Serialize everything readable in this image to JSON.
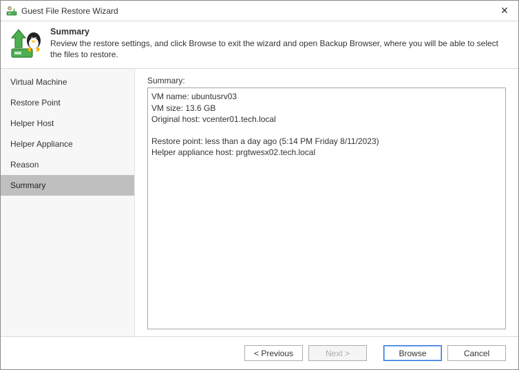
{
  "window": {
    "title": "Guest File Restore Wizard",
    "close_glyph": "✕"
  },
  "header": {
    "title": "Summary",
    "description": "Review the restore settings, and click Browse to exit the wizard and open Backup Browser, where you will be able to select the files to restore."
  },
  "sidebar": {
    "steps": [
      {
        "label": "Virtual Machine",
        "active": false
      },
      {
        "label": "Restore Point",
        "active": false
      },
      {
        "label": "Helper Host",
        "active": false
      },
      {
        "label": "Helper Appliance",
        "active": false
      },
      {
        "label": "Reason",
        "active": false
      },
      {
        "label": "Summary",
        "active": true
      }
    ]
  },
  "main": {
    "field_label": "Summary:",
    "summary_text": "VM name: ubuntusrv03\nVM size: 13.6 GB\nOriginal host: vcenter01.tech.local\n\nRestore point: less than a day ago (5:14 PM Friday 8/11/2023)\nHelper appliance host: prgtwesx02.tech.local"
  },
  "footer": {
    "previous": "< Previous",
    "next": "Next >",
    "browse": "Browse",
    "cancel": "Cancel"
  },
  "colors": {
    "accent": "#2a6fd6"
  }
}
